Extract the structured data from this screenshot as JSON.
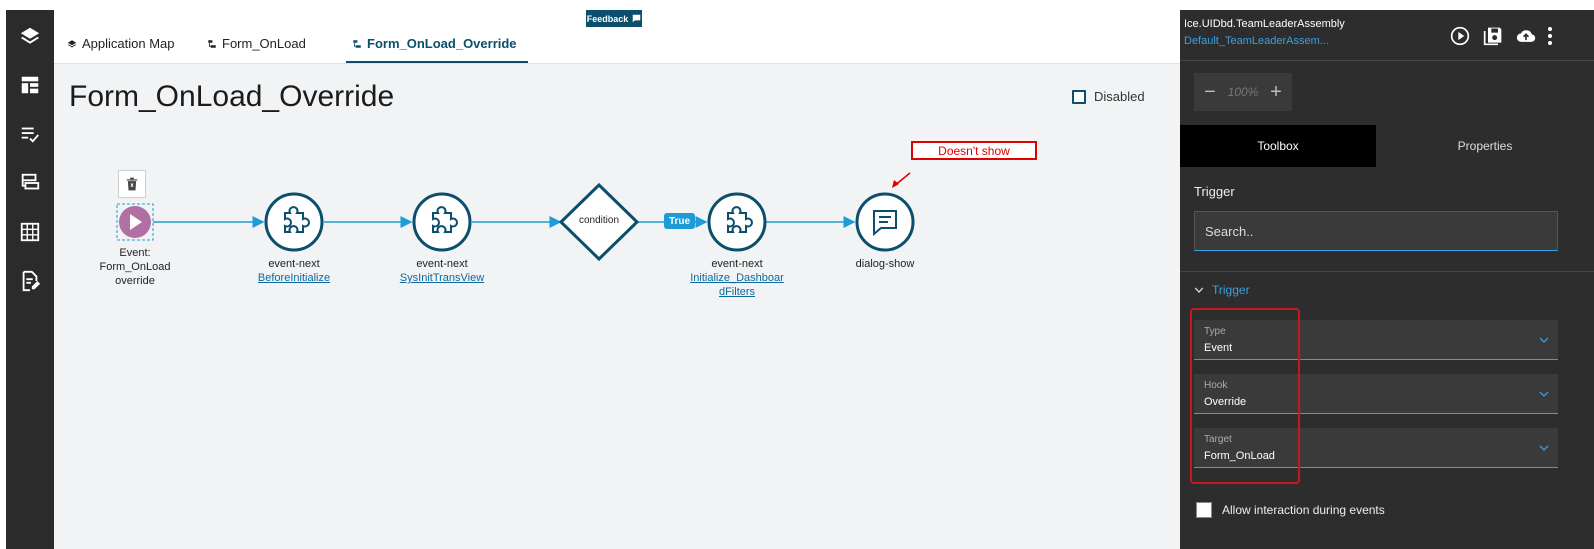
{
  "tabs": [
    {
      "label": "Application Map"
    },
    {
      "label": "Form_OnLoad"
    },
    {
      "label": "Form_OnLoad_Override"
    }
  ],
  "feedback": {
    "label": "Feedback"
  },
  "page": {
    "title": "Form_OnLoad_Override",
    "disabled_label": "Disabled"
  },
  "canvas": {
    "note": "Doesn't show",
    "true_label": "True",
    "nodes": {
      "event": {
        "line1": "Event:",
        "line2": "Form_OnLoad",
        "line3": "override"
      },
      "n1": {
        "type": "event-next",
        "link": "BeforeInitialize"
      },
      "n2": {
        "type": "event-next",
        "link": "SysInitTransView"
      },
      "cond": {
        "label": "condition"
      },
      "n3": {
        "type": "event-next",
        "link1": "Initialize_Dashboar",
        "link2": "dFilters"
      },
      "n4": {
        "type": "dialog-show"
      }
    }
  },
  "panel": {
    "title": "Ice.UIDbd.TeamLeaderAssembly",
    "subtitle": "Default_TeamLeaderAssem...",
    "zoom": "100%",
    "tabs": {
      "toolbox": "Toolbox",
      "properties": "Properties"
    },
    "section_label": "Trigger",
    "search_placeholder": "Search..",
    "group_label": "Trigger",
    "fields": {
      "type": {
        "label": "Type",
        "value": "Event"
      },
      "hook": {
        "label": "Hook",
        "value": "Override"
      },
      "target": {
        "label": "Target",
        "value": "Form_OnLoad"
      }
    },
    "allow_label": "Allow interaction during events"
  },
  "colors": {
    "accent": "#0b4f6c",
    "link": "#3aa0e0",
    "flow": "#1f9bd7",
    "event": "#b26fa3",
    "alert": "#e00000"
  }
}
